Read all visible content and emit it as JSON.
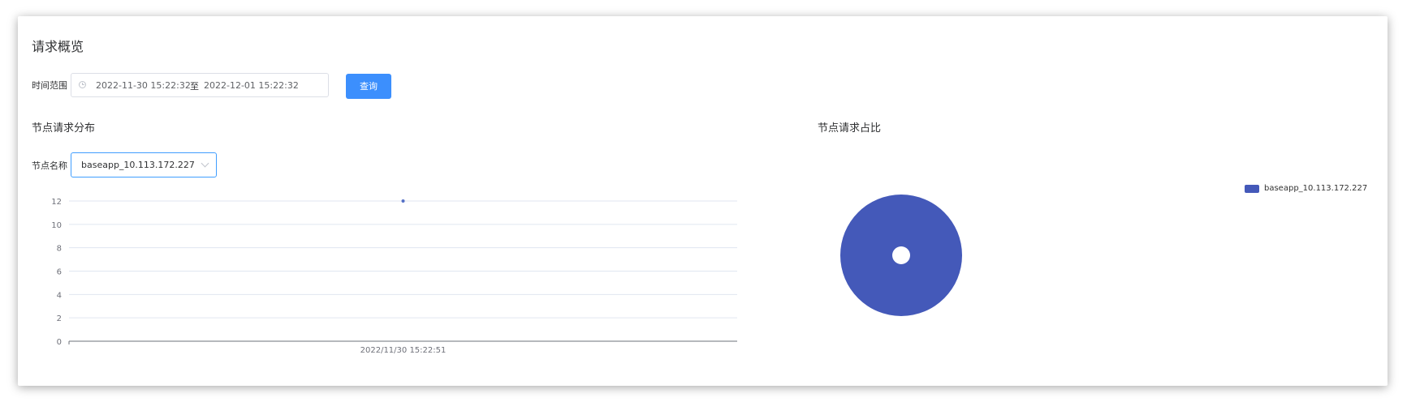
{
  "page": {
    "title": "请求概览"
  },
  "filter": {
    "time_label": "时间范围",
    "start": "2022-11-30 15:22:32",
    "separator": "至",
    "end": "2022-12-01 15:22:32",
    "query_label": "查询"
  },
  "distribution": {
    "title": "节点请求分布",
    "node_label": "节点名称",
    "node_value": "baseapp_10.113.172.227"
  },
  "ratio": {
    "title": "节点请求占比"
  },
  "colors": {
    "accent": "#3c8ffd",
    "series": "#4459b9",
    "line_point": "#5470c6"
  },
  "icons": {
    "clock": "clock-icon",
    "chevron": "chevron-down-icon"
  },
  "chart_data": [
    {
      "type": "line",
      "x": [
        "2022/11/30 15:22:51"
      ],
      "series": [
        {
          "values": [
            12
          ]
        }
      ],
      "ylim": [
        0,
        12
      ],
      "yticks": [
        0,
        2,
        4,
        6,
        8,
        10,
        12
      ],
      "grid": true
    },
    {
      "type": "pie",
      "labels": [
        "baseapp_10.113.172.227"
      ],
      "values": [
        1
      ],
      "legend": [
        "baseapp_10.113.172.227"
      ],
      "legend_position": "top-right"
    }
  ]
}
